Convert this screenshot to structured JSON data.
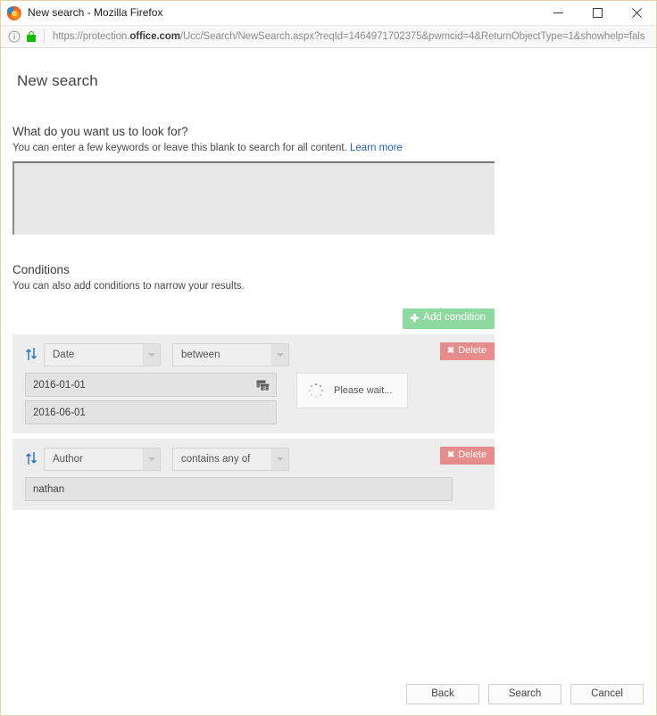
{
  "window": {
    "title": "New search - Mozilla Firefox",
    "app_icon": "firefox-logo-icon",
    "minimize_label": "Minimize",
    "maximize_label": "Maximize",
    "close_label": "Close"
  },
  "urlbar": {
    "info_icon": "page-info-icon",
    "lock_icon": "padlock-secure-icon",
    "scheme": "https://protection.",
    "host_bold": "office.com",
    "path": "/Ucc/Search/NewSearch.aspx?reqId=1464971702375&pwmcid=4&ReturnObjectType=1&showhelp=fals",
    "full_url": "https://protection.office.com/Ucc/Search/NewSearch.aspx?reqId=1464971702375&pwmcid=4&ReturnObjectType=1&showhelp=fals"
  },
  "page": {
    "title": "New search",
    "look_for": {
      "heading": "What do you want us to look for?",
      "subtext": "You can enter a few keywords or leave this blank to search for all content.",
      "link_label": "Learn more",
      "keywords_value": "",
      "keywords_placeholder": ""
    },
    "conditions": {
      "heading": "Conditions",
      "subtext": "You can also add conditions to narrow your results.",
      "add_button_label": "Add condition",
      "add_button_icon": "plus-icon",
      "delete_button_label": "Delete",
      "delete_button_icon": "close-x-icon",
      "sort_icon": "sort-updown-icon",
      "rows": [
        {
          "field": "Date",
          "operator": "between",
          "value_from": "2016-01-01",
          "value_to": "2016-06-01",
          "calendar_icon": "calendar-picker-icon",
          "status": "Please wait...",
          "status_icon": "loading-spinner-icon"
        },
        {
          "field": "Author",
          "operator": "contains any of",
          "value": "nathan"
        }
      ]
    }
  },
  "footer": {
    "back_label": "Back",
    "search_label": "Search",
    "cancel_label": "Cancel"
  },
  "colors": {
    "accent_green": "#8ed9a0",
    "accent_red": "#e58c8c",
    "link_blue": "#2464a4",
    "lock_green": "#12bc00",
    "sort_blue": "#2b7cc4",
    "panel_gray": "#ededed"
  }
}
